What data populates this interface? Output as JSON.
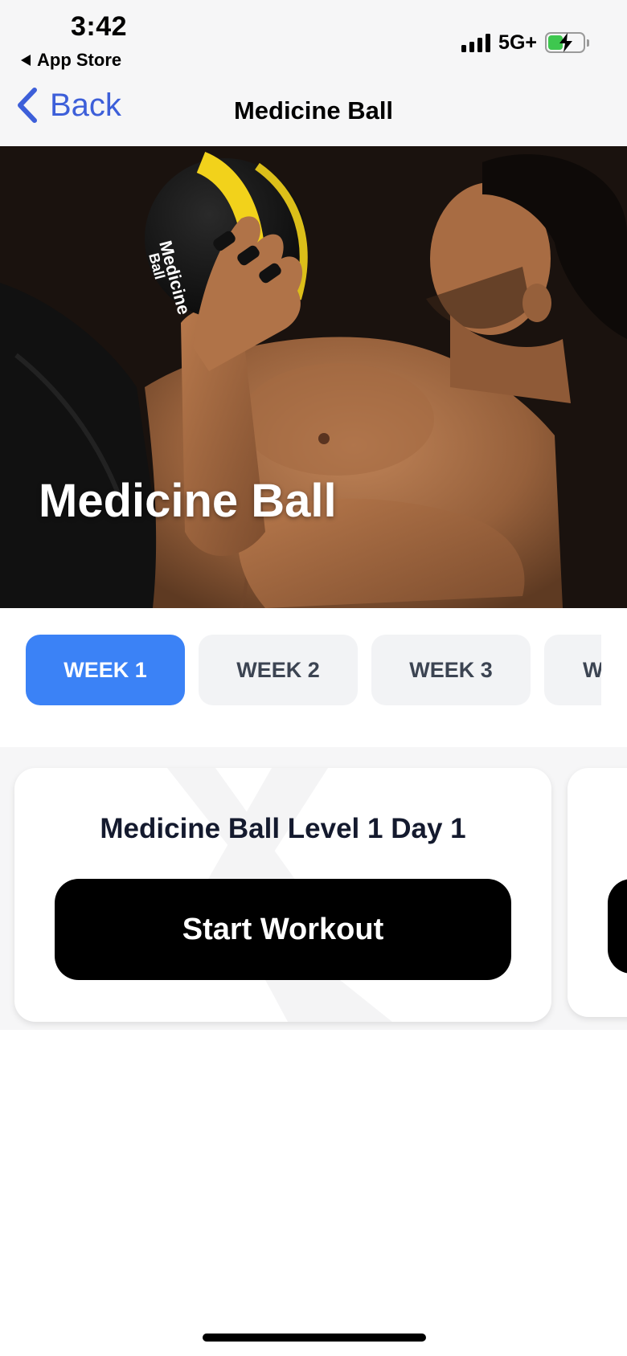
{
  "status_bar": {
    "time": "3:42",
    "back_app_label": "App Store",
    "network": "5G+",
    "battery_level": 0.45,
    "battery_color": "#3ec74f"
  },
  "nav": {
    "back_label": "Back",
    "title": "Medicine Ball",
    "accent_color": "#3d5fd9"
  },
  "hero": {
    "title": "Medicine Ball",
    "image_alt": "man lying on back holding a black and yellow medicine ball"
  },
  "weeks": {
    "active_color": "#3b82f6",
    "tabs": [
      {
        "label": "WEEK 1",
        "active": true
      },
      {
        "label": "WEEK 2",
        "active": false
      },
      {
        "label": "WEEK 3",
        "active": false
      },
      {
        "label": "W",
        "active": false
      }
    ]
  },
  "workout_card": {
    "title": "Medicine Ball Level 1 Day 1",
    "button_label": "Start Workout"
  }
}
